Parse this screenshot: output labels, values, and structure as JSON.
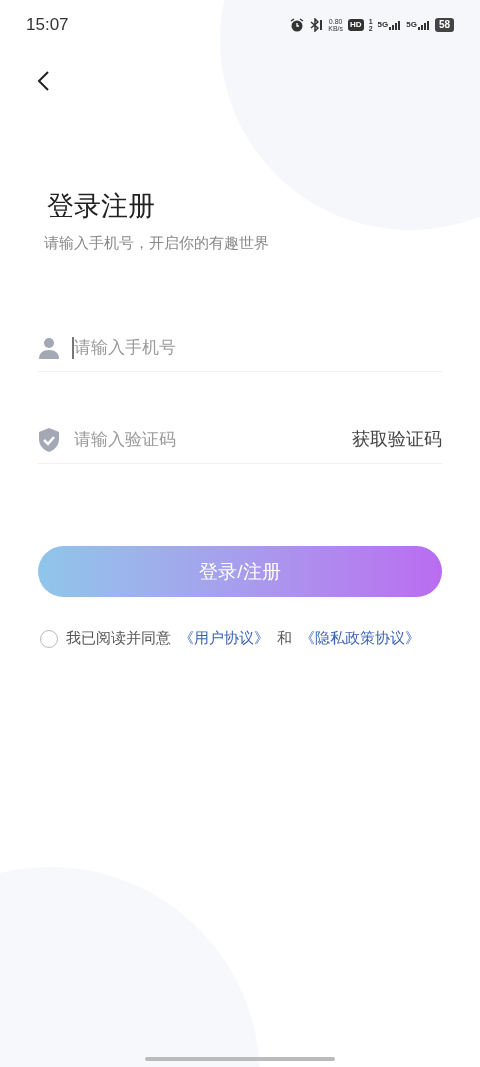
{
  "status_bar": {
    "time": "15:07",
    "net_speed": [
      "0.80",
      "KB/s"
    ],
    "hd": "HD",
    "sim_slots": [
      "1",
      "2"
    ],
    "networks": [
      "5G",
      "5G"
    ],
    "battery": "58"
  },
  "title": "登录注册",
  "subtitle": "请输入手机号，开启你的有趣世界",
  "fields": [
    {
      "kind": "phone",
      "placeholder": "请输入手机号",
      "focused": true
    },
    {
      "kind": "code",
      "placeholder": "请输入验证码",
      "focused": false,
      "action": "获取验证码"
    }
  ],
  "submit": "登录/注册",
  "agreement": {
    "checked": false,
    "text": "我已阅读并同意",
    "links": [
      "《用户协议》",
      "《隐私政策协议》"
    ],
    "joiner": "和"
  }
}
